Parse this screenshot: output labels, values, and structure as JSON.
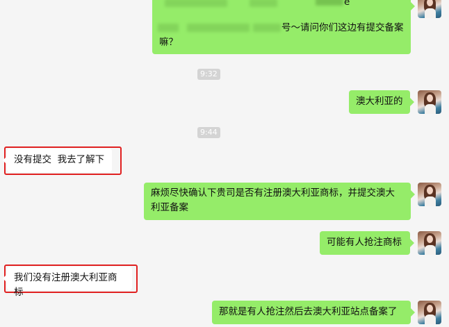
{
  "messages": [
    {
      "id": "msg-0",
      "direction": "out",
      "lines": [
        "e",
        "号～请问你们这边有提交备案",
        "嘛？"
      ],
      "note_visible": "partially redacted"
    },
    {
      "id": "time-1",
      "type": "time",
      "text": "9:32"
    },
    {
      "id": "msg-1",
      "direction": "out",
      "text": "澳大利亚的"
    },
    {
      "id": "time-2",
      "type": "time",
      "text": "9:44"
    },
    {
      "id": "msg-2",
      "direction": "in",
      "text": "没有提交  我去了解下",
      "highlighted": true
    },
    {
      "id": "msg-3",
      "direction": "out",
      "lines": [
        "麻烦尽快确认下贵司是否有注册澳大利亚商标，并提交澳大",
        "利亚备案"
      ]
    },
    {
      "id": "msg-4",
      "direction": "out",
      "text": "可能有人抢注商标"
    },
    {
      "id": "msg-5",
      "direction": "in",
      "text": "我们没有注册澳大利亚商标",
      "highlighted": true
    },
    {
      "id": "msg-6",
      "direction": "out",
      "text": "那就是有人抢注然后去澳大利亚站点备案了"
    }
  ],
  "colors": {
    "background": "#f5f5f5",
    "outgoing_bubble": "#95ec69",
    "incoming_bubble": "#ffffff",
    "highlight_frame": "#e02020",
    "timestamp_bg": "#d4d4d4"
  },
  "icons": {
    "self_avatar": "user-avatar-photo"
  }
}
